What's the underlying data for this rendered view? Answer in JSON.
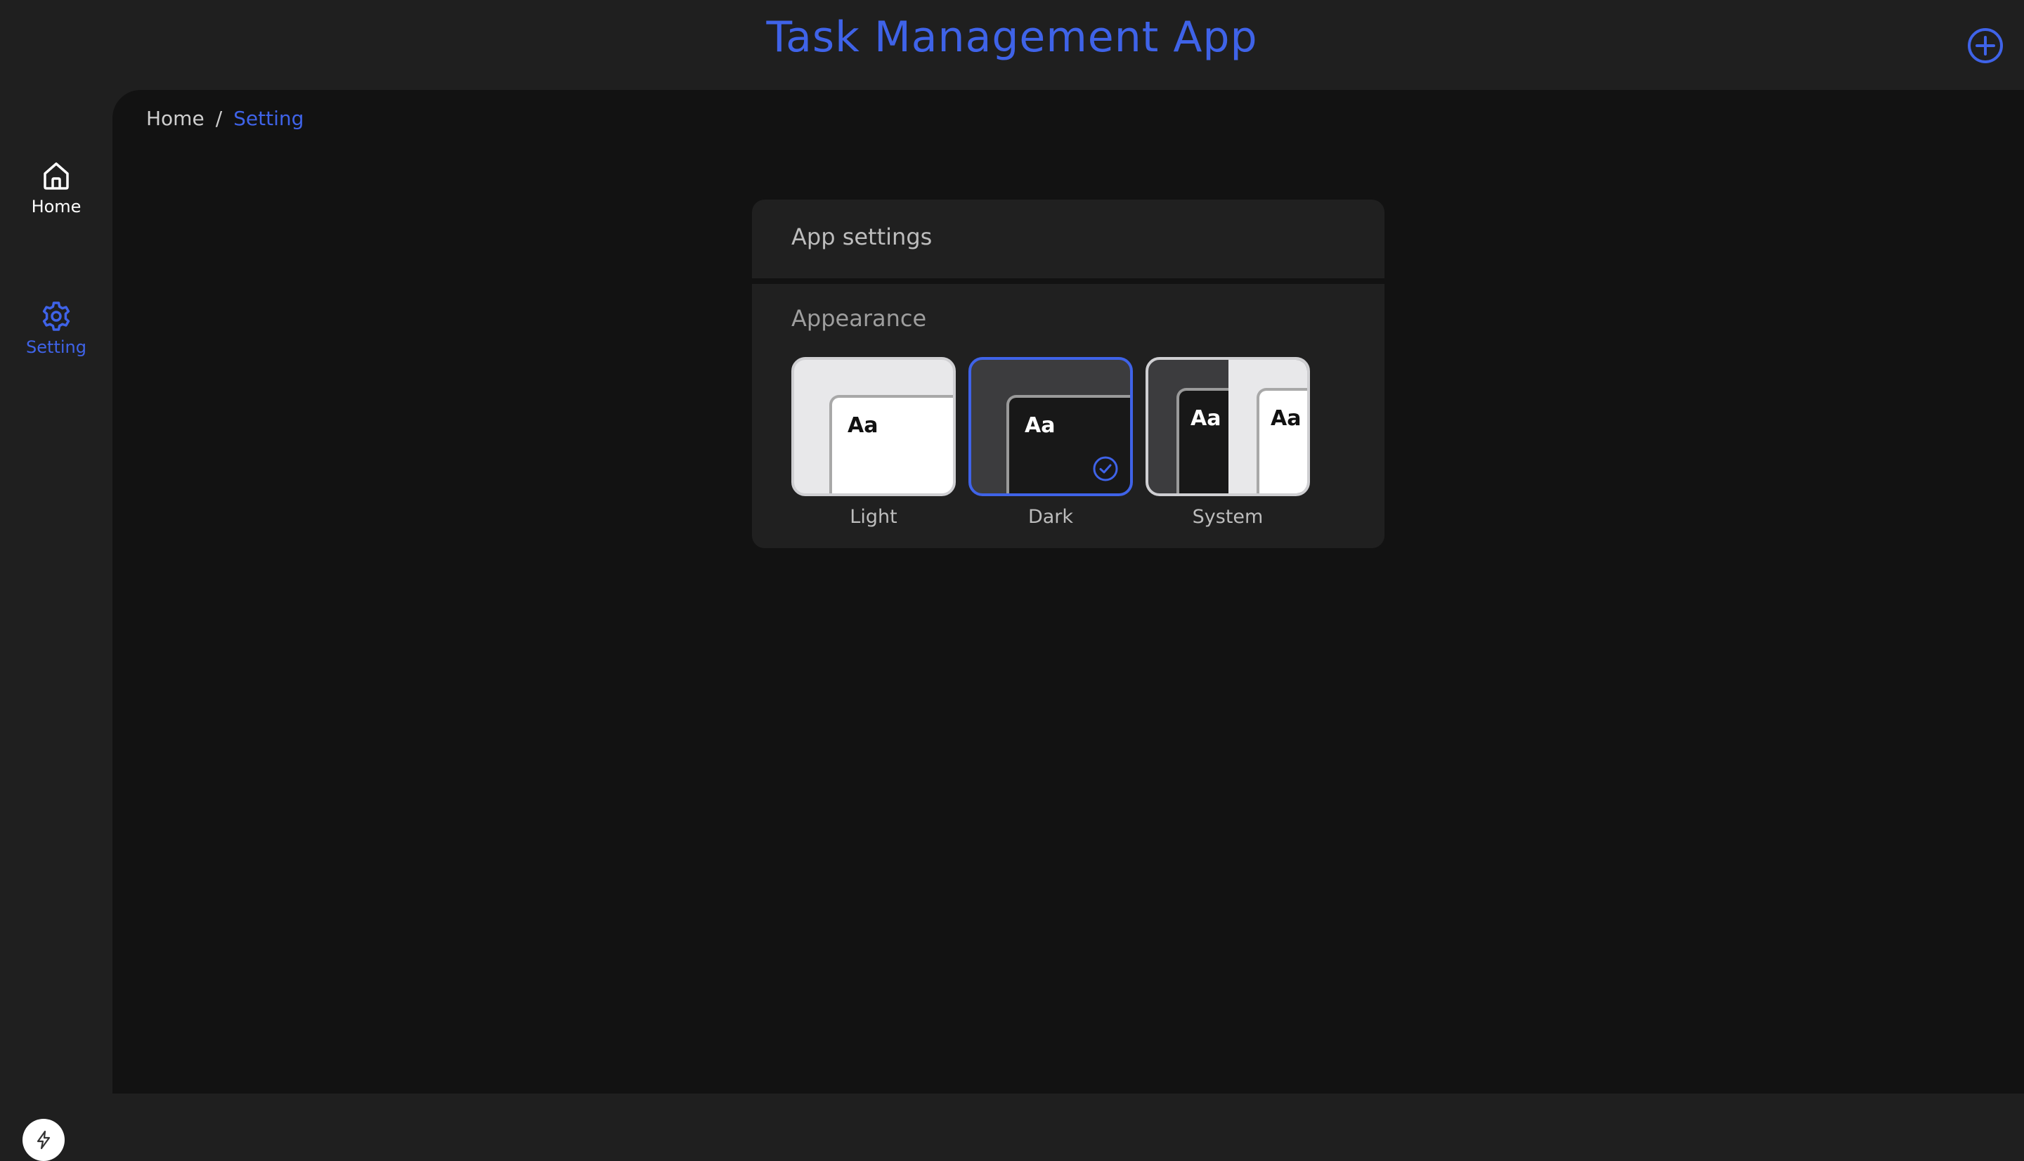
{
  "header": {
    "title": "Task Management App",
    "add_icon": "plus-circle-icon"
  },
  "sidebar": {
    "items": [
      {
        "label": "Home",
        "icon": "home-icon",
        "active": false
      },
      {
        "label": "Setting",
        "icon": "gear-icon",
        "active": true
      }
    ],
    "footer_icon": "lightning-icon"
  },
  "breadcrumb": {
    "home": "Home",
    "separator": "/",
    "current": "Setting"
  },
  "settings": {
    "title": "App settings",
    "appearance": {
      "label": "Appearance",
      "sample_text": "Aa",
      "selected": "Dark",
      "options": [
        {
          "label": "Light"
        },
        {
          "label": "Dark"
        },
        {
          "label": "System"
        }
      ]
    }
  },
  "colors": {
    "accent": "#3f63e8",
    "page_bg": "#121212",
    "panel_bg": "#1f1f1f",
    "card_bg": "#202020"
  }
}
